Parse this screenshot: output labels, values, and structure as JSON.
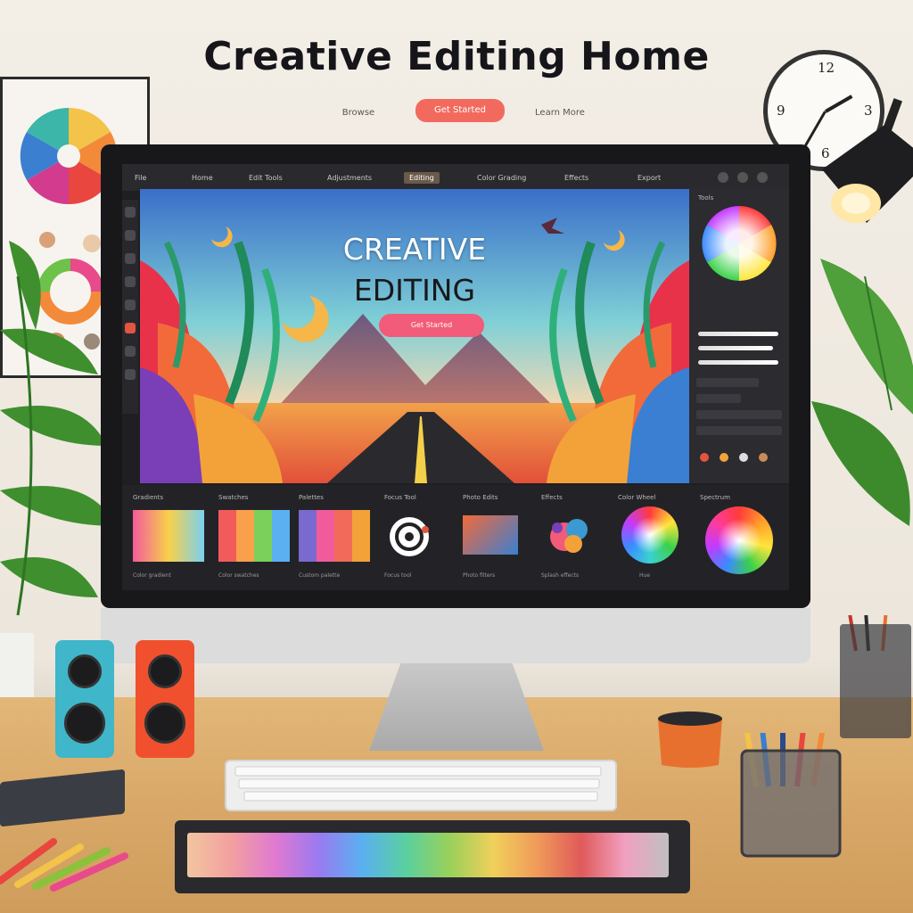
{
  "header": {
    "title": "Creative Editing Home",
    "nav": [
      "Browse",
      "Get Started",
      "Learn More"
    ]
  },
  "app": {
    "menu": [
      "File",
      "Home",
      "Edit Tools",
      "Adjustments",
      "Editing",
      "Color Grading",
      "Effects",
      "Export"
    ],
    "active_menu_index": 4,
    "canvas": {
      "title_line_1": "CREATIVE",
      "title_line_2": "EDITING",
      "button_label": "Get Started"
    },
    "presets": [
      {
        "label": "Gradients",
        "caption": "Color gradient"
      },
      {
        "label": "Swatches",
        "caption": "Color swatches"
      },
      {
        "label": "Palettes",
        "caption": "Custom palette"
      },
      {
        "label": "Focus Tool",
        "caption": "Focus tool"
      },
      {
        "label": "Photo Edits",
        "caption": "Photo filters"
      },
      {
        "label": "Effects",
        "caption": "Splash effects"
      },
      {
        "label": "Color Wheel",
        "caption": "Hue"
      },
      {
        "label": "Spectrum",
        "caption": ""
      }
    ],
    "panel": {
      "label": "Tools"
    }
  },
  "clock": {
    "numbers": [
      "12",
      "3",
      "6",
      "9"
    ]
  },
  "colors": {
    "accent": "#f26a5e",
    "canvas_button": "#f25b7a",
    "screen_bg": "#1f1f23",
    "desk": "#d9a868"
  },
  "icons": [
    "clock-icon",
    "lamp-icon",
    "plant-icon",
    "speaker-icon",
    "keyboard-icon",
    "color-wheel-icon",
    "pencil-icon",
    "mug-icon"
  ]
}
